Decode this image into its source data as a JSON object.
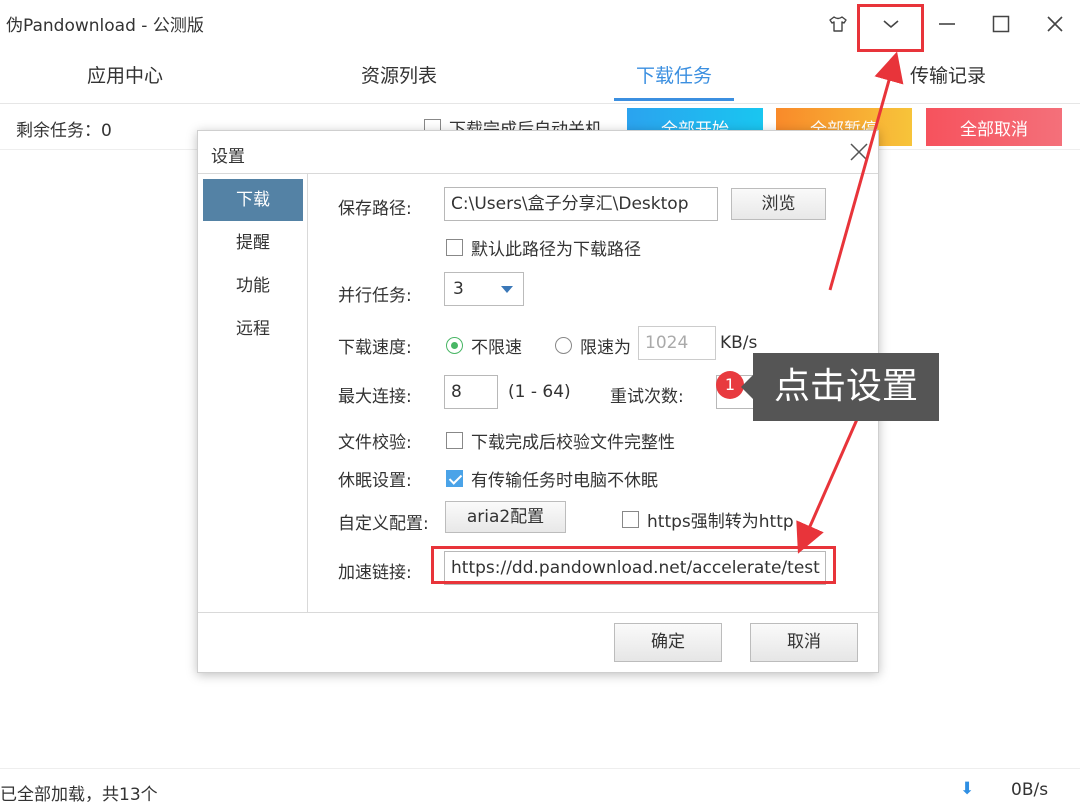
{
  "app": {
    "title": "伪Pandownload - 公测版"
  },
  "window_controls": {
    "skin": "shirt-icon",
    "menu": "chevron-down-icon",
    "minimize": "minimize-icon",
    "maximize": "maximize-icon",
    "close": "close-icon"
  },
  "nav": {
    "tabs": [
      {
        "label": "应用中心"
      },
      {
        "label": "资源列表"
      },
      {
        "label": "下载任务"
      },
      {
        "label": "传输记录"
      }
    ],
    "active": "下载任务"
  },
  "taskbar": {
    "remaining": "剩余任务：0",
    "auto_shutdown": "下载完成后自动关机",
    "start_all": "全部开始",
    "pause_all": "全部暂停",
    "cancel_all": "全部取消"
  },
  "status": {
    "loaded": "已全部加载，共13个",
    "speed": "0B/s"
  },
  "dialog": {
    "title": "设置",
    "sidebar": [
      "下载",
      "提醒",
      "功能",
      "远程"
    ],
    "save_path_label": "保存路径:",
    "save_path_value": "C:\\Users\\盒子分享汇\\Desktop",
    "browse": "浏览",
    "default_path": "默认此路径为下载路径",
    "parallel_label": "并行任务:",
    "parallel_value": "3",
    "speed_label": "下载速度:",
    "unlimited": "不限速",
    "limit_to": "限速为",
    "limit_value": "1024",
    "limit_unit": "KB/s",
    "max_conn_label": "最大连接:",
    "max_conn_value": "8",
    "max_conn_range": "(1 - 64)",
    "retry_label": "重试次数:",
    "verify_label": "文件校验:",
    "verify_text": "下载完成后校验文件完整性",
    "sleep_label": "休眠设置:",
    "sleep_text": "有传输任务时电脑不休眠",
    "custom_label": "自定义配置:",
    "aria2": "aria2配置",
    "https_text": "https强制转为http",
    "accel_label": "加速链接:",
    "accel_value": "https://dd.pandownload.net/accelerate/test",
    "ok": "确定",
    "cancel": "取消"
  },
  "annotation": {
    "badge": "1",
    "callout": "点击设置",
    "color": "#e8343a"
  }
}
